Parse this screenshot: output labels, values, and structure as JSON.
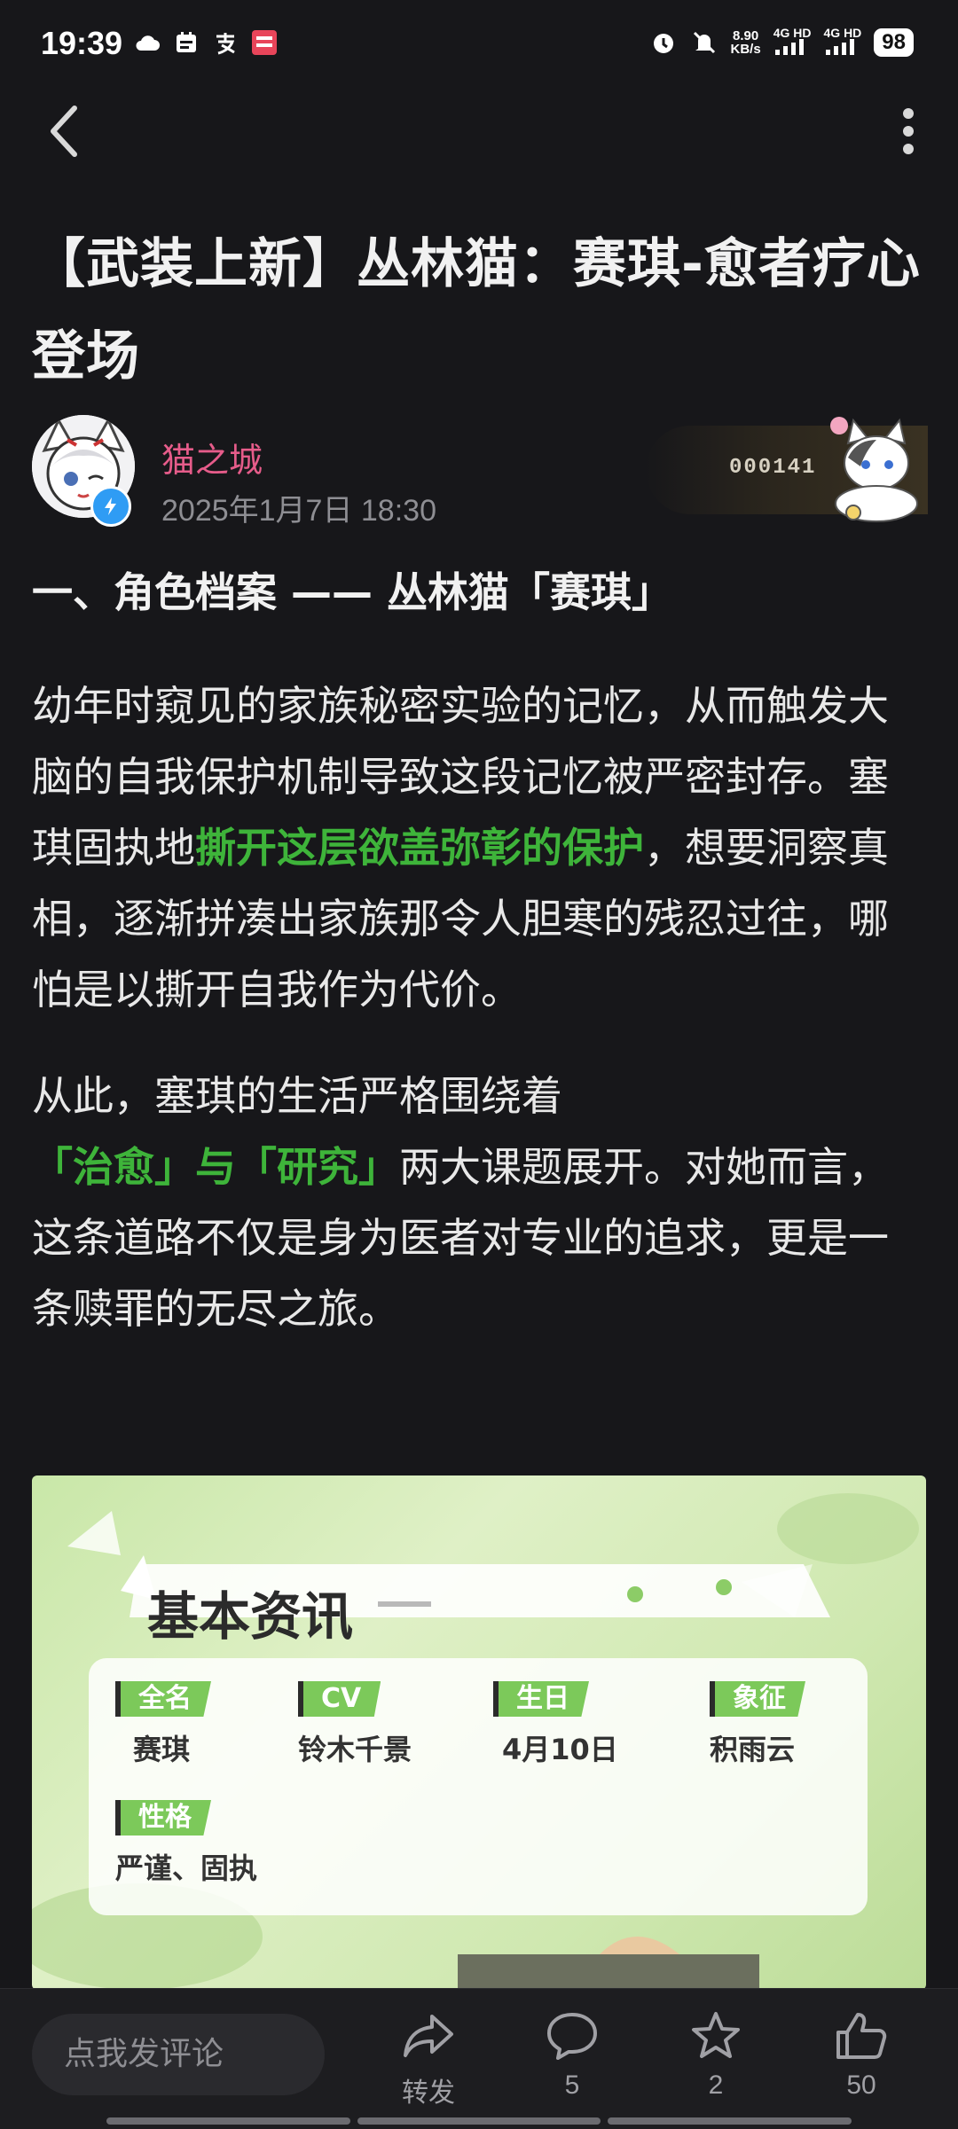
{
  "status_bar": {
    "time": "19:39",
    "speed_value": "8.90",
    "speed_unit": "KB/s",
    "net1": "4G HD",
    "net2": "4G HD",
    "battery": "98"
  },
  "article": {
    "title": "【武装上新】丛林猫：赛琪-愈者疗心登场",
    "author_name": "猫之城",
    "date": "2025年1月7日 18:30",
    "decoration_number": "000141",
    "section_heading": "一、角色档案 —— 丛林猫「赛琪」",
    "paragraph1": {
      "before": "幼年时窥见的家族秘密实验的记忆，从而触发大脑的自我保护机制导致这段记忆被严密封存。塞琪固执地",
      "highlight": "撕开这层欲盖弥彰的保护",
      "after": "，想要洞察真相，逐渐拼凑出家族那令人胆寒的残忍过往，哪怕是以撕开自我作为代价。"
    },
    "paragraph2": {
      "before": "从此，塞琪的生活严格围绕着",
      "highlight": "「治愈」与「研究」",
      "after": "两大课题展开。对她而言，这条道路不仅是身为医者对专业的追求，更是一条赎罪的无尽之旅。"
    }
  },
  "info_card": {
    "title": "基本资讯",
    "fields": [
      {
        "label": "全名",
        "value": "赛琪"
      },
      {
        "label": "CV",
        "value": "铃木千景"
      },
      {
        "label": "生日",
        "value": "4月10日"
      },
      {
        "label": "象征",
        "value": "积雨云"
      },
      {
        "label": "性格",
        "value": "严谨、固执"
      }
    ]
  },
  "bottom_bar": {
    "comment_placeholder": "点我发评论",
    "share_label": "转发",
    "comment_count": "5",
    "favorite_count": "2",
    "like_count": "50"
  },
  "colors": {
    "background": "#17171a",
    "highlight": "#3eb43a",
    "author": "#e65c8a"
  }
}
